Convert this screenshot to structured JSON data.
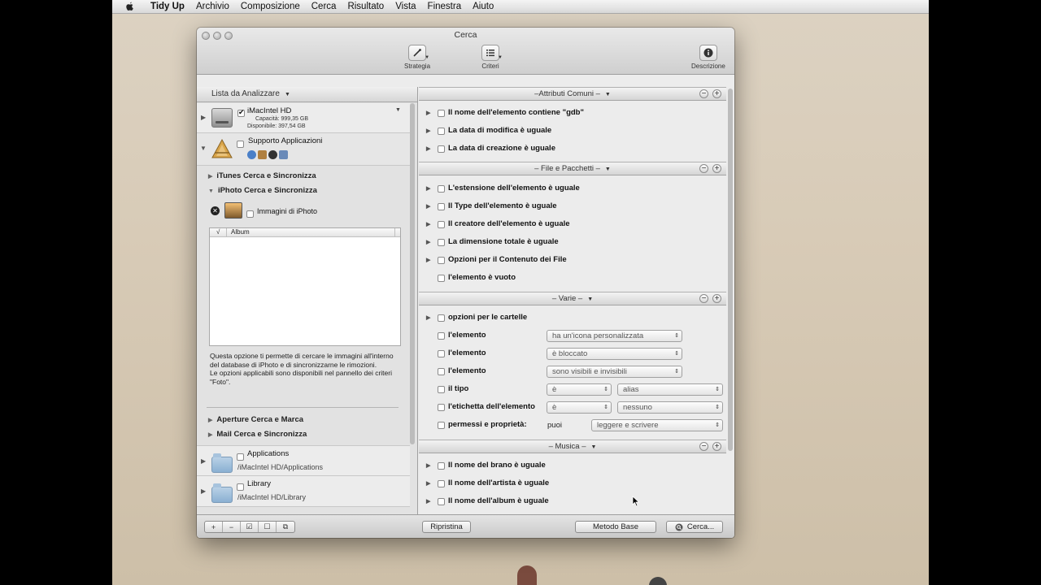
{
  "menubar": {
    "app_name": "Tidy Up",
    "items": [
      "Archivio",
      "Composizione",
      "Cerca",
      "Risultato",
      "Vista",
      "Finestra",
      "Aiuto"
    ]
  },
  "window": {
    "title": "Cerca",
    "toolbar": {
      "strategy_label": "Strategia",
      "criteria_label": "Criteri",
      "description_label": "Descrizione"
    }
  },
  "left": {
    "header": "Lista da Analizzare",
    "disk": {
      "name": "iMacIntel HD",
      "capacity": "Capacità: 999,35 GB",
      "available": "Disponibile: 397,54 GB",
      "checked": true
    },
    "app_support": {
      "name": "Supporto Applicazioni",
      "checked": false
    },
    "sections": {
      "itunes": "iTunes Cerca e Sincronizza",
      "iphoto": "iPhoto Cerca e Sincronizza",
      "aperture": "Aperture Cerca e Marca",
      "mail": "Mail Cerca e Sincronizza"
    },
    "iphoto_images_label": "Immagini di iPhoto",
    "album_table": {
      "check_header": "√",
      "column_header": "Album"
    },
    "help_text": "Questa opzione ti permette di cercare le immagini all'interno del database di iPhoto e di sincronizzarne le rimozioni.\nLe opzioni applicabili sono disponibili nel pannello dei criteri \"Foto\".",
    "folders": [
      {
        "name": "Applications",
        "path": "/iMacIntel HD/Applications"
      },
      {
        "name": "Library",
        "path": "/iMacIntel HD/Library"
      }
    ]
  },
  "right": {
    "groups": {
      "common": "–Attributi Comuni –",
      "files": "– File e Pacchetti –",
      "misc": "– Varie –",
      "music": "– Musica –"
    },
    "common_rows": [
      "Il nome dell'elemento contiene \"gdb\"",
      "La data di modifica è uguale",
      "La data di creazione è uguale"
    ],
    "file_rows": [
      "L'estensione dell'elemento è uguale",
      "Il Type dell'elemento è uguale",
      "Il creatore dell'elemento è uguale",
      "La dimensione totale è uguale",
      "Opzioni per il Contenuto dei File",
      "l'elemento è vuoto"
    ],
    "misc": {
      "folder_options": "opzioni per le cartelle",
      "item1": {
        "label": "l'elemento",
        "value": "ha un'icona personalizzata"
      },
      "item2": {
        "label": "l'elemento",
        "value": "è bloccato"
      },
      "item3": {
        "label": "l'elemento",
        "value": "sono visibili e invisibili"
      },
      "type": {
        "label": "il tipo",
        "op": "è",
        "value": "alias"
      },
      "tag": {
        "label": "l'etichetta dell'elemento",
        "op": "è",
        "value": "nessuno"
      },
      "perm": {
        "label": "permessi e proprietà:",
        "op": "puoi",
        "value": "leggere e scrivere"
      }
    },
    "music_rows": [
      "Il nome del brano è uguale",
      "Il nome dell'artista è uguale",
      "Il nome dell'album è uguale"
    ]
  },
  "bottom": {
    "reset": "Ripristina",
    "basic": "Metodo Base",
    "search": "Cerca..."
  }
}
